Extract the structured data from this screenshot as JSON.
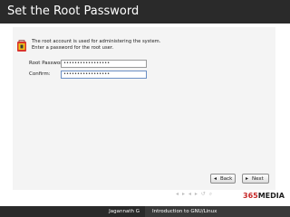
{
  "slide": {
    "title": "Set the Root Password"
  },
  "installer": {
    "info_text": "The root account is used for administering the system.  Enter a password for the root user.",
    "root_password_label": "Root Password:",
    "root_password_value": "•••••••••••••••••",
    "confirm_label": "Confirm:",
    "confirm_value": "•••••••••••••••••",
    "back_label": "Back",
    "next_label": "Next"
  },
  "footer": {
    "author": "Jagannath G",
    "course": "Introduction to GNU/Linux",
    "logo_part1": "365",
    "logo_part2": "MEDIA"
  },
  "colors": {
    "title_bar": "#2a2a2a",
    "logo_red": "#c62828",
    "footer_left": "#2a2a2a",
    "footer_right": "#3a3a3a"
  }
}
